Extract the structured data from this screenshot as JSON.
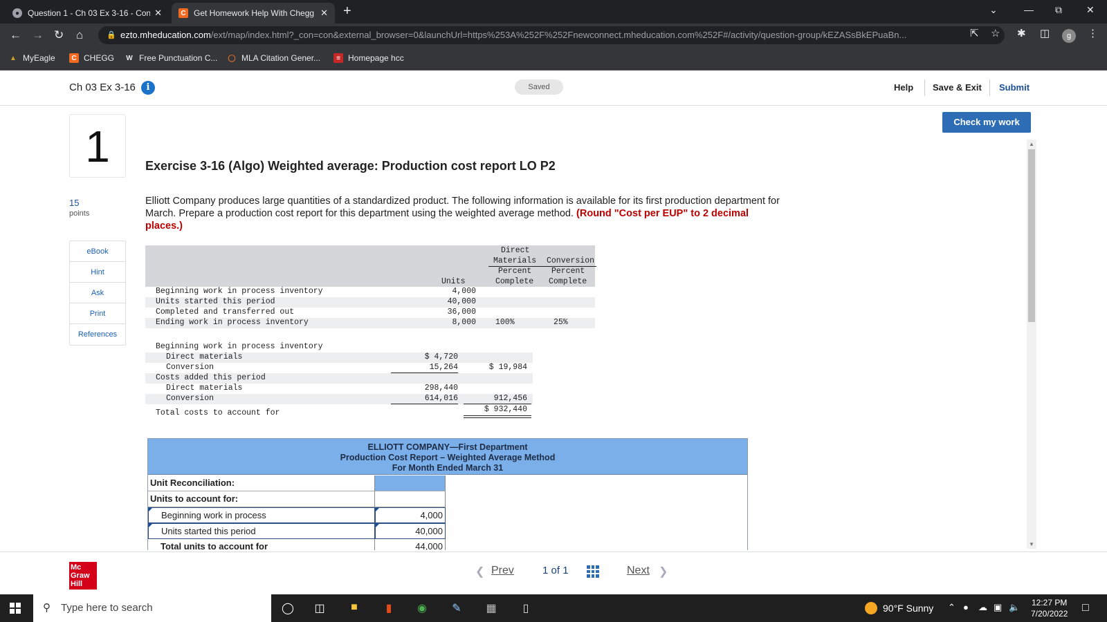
{
  "browser": {
    "tabs": [
      {
        "title": "Question 1 - Ch 03 Ex 3-16 - Con",
        "active": false
      },
      {
        "title": "Get Homework Help With Chegg",
        "active": true
      }
    ],
    "url_host": "ezto.mheducation.com",
    "url_path": "/ext/map/index.html?_con=con&external_browser=0&launchUrl=https%253A%252F%252Fnewconnect.mheducation.com%252F#/activity/question-group/kEZASsBkEPuaBn...",
    "profile_initial": "g",
    "bookmarks": [
      "MyEagle",
      "CHEGG",
      "Free Punctuation C...",
      "MLA Citation Gener...",
      "Homepage hcc"
    ]
  },
  "header": {
    "title": "Ch 03 Ex 3-16",
    "saved": "Saved",
    "help": "Help",
    "save_exit": "Save & Exit",
    "submit": "Submit"
  },
  "question": {
    "number": "1",
    "points": "15",
    "points_label": "points",
    "tools": [
      "eBook",
      "Hint",
      "Ask",
      "Print",
      "References"
    ],
    "check_button": "Check my work",
    "heading": "Exercise 3-16 (Algo) Weighted average: Production cost report LO P2",
    "text": "Elliott Company produces large quantities of a standardized product. The following information is available for its first production department for March. Prepare a production cost report for this department using the weighted average method.",
    "instruction": "(Round \"Cost per EUP\" to 2 decimal places.)"
  },
  "units_table": {
    "head": {
      "dm": "Direct",
      "dm2": "Materials",
      "conv": "Conversion",
      "units": "Units",
      "pc1": "Percent",
      "c1": "Complete",
      "pc2": "Percent",
      "c2": "Complete"
    },
    "rows": [
      {
        "label": "Beginning work in process inventory",
        "units": "4,000",
        "dm": "",
        "conv": ""
      },
      {
        "label": "Units started this period",
        "units": "40,000",
        "dm": "",
        "conv": ""
      },
      {
        "label": "Completed and transferred out",
        "units": "36,000",
        "dm": "",
        "conv": ""
      },
      {
        "label": "Ending work in process inventory",
        "units": "8,000",
        "dm": "100%",
        "conv": "25%"
      }
    ]
  },
  "cost_table": {
    "beg_label": "Beginning work in process inventory",
    "dm_label": "Direct materials",
    "dm_beg": "$ 4,720",
    "conv_label": "Conversion",
    "conv_beg": "15,264",
    "beg_total": "$ 19,984",
    "added_label": "Costs added this period",
    "dm_added_label": "Direct materials",
    "dm_added": "298,440",
    "conv_added_label": "Conversion",
    "conv_added": "614,016",
    "added_total": "912,456",
    "total_label": "Total costs to account for",
    "total": "$ 932,440"
  },
  "report": {
    "title1": "ELLIOTT COMPANY—First Department",
    "title2": "Production Cost Report – Weighted Average Method",
    "title3": "For Month Ended March 31",
    "rows": [
      {
        "label": "Unit Reconciliation:",
        "value": ""
      },
      {
        "label": "Units to account for:",
        "value": ""
      },
      {
        "label": "Beginning work in process",
        "value": "4,000"
      },
      {
        "label": "Units started this period",
        "value": "40,000"
      },
      {
        "label": "Total units to account for",
        "value": "44,000"
      }
    ]
  },
  "footer": {
    "prev": "Prev",
    "page": "1",
    "of": "of",
    "total": "1",
    "next": "Next"
  },
  "taskbar": {
    "search_placeholder": "Type here to search",
    "weather": "90°F  Sunny",
    "time": "12:27 PM",
    "date": "7/20/2022"
  }
}
